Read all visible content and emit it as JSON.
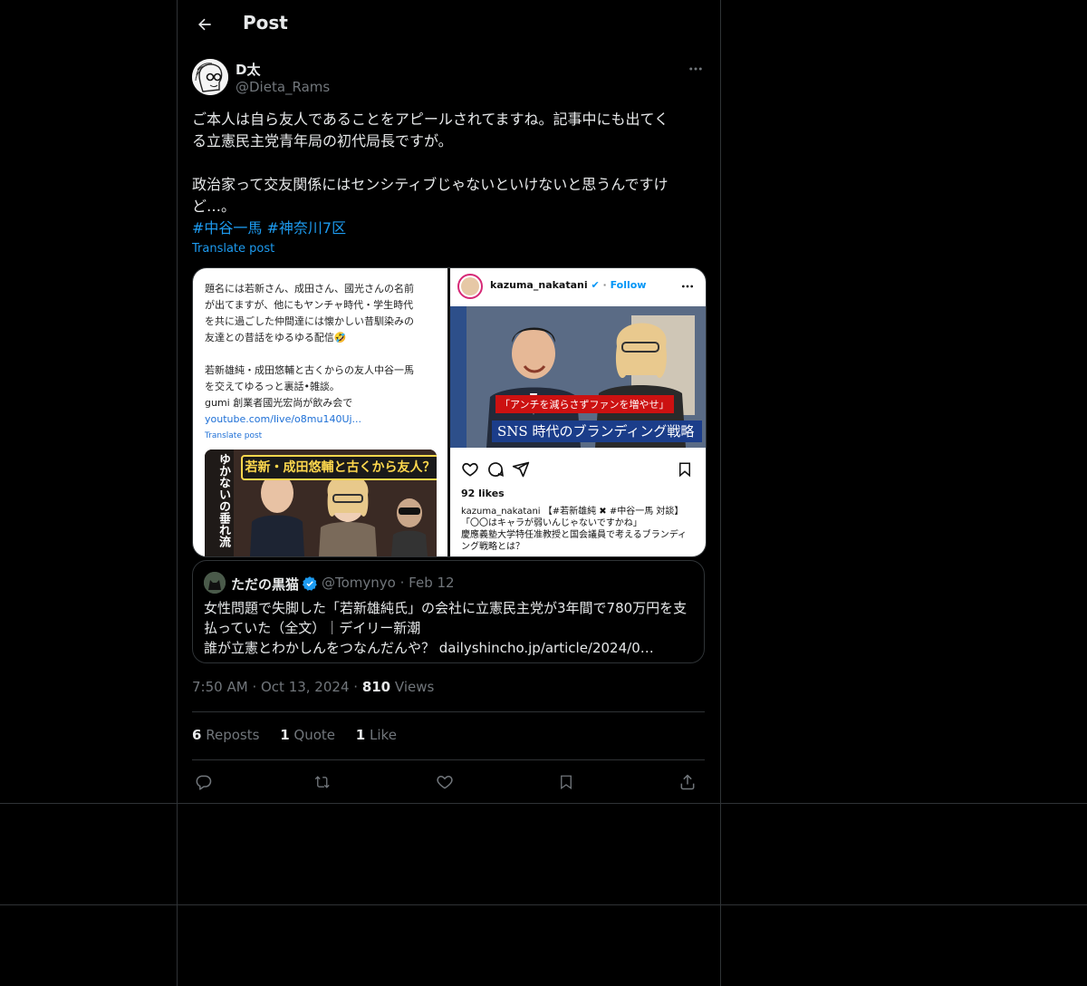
{
  "header": {
    "title": "Post"
  },
  "post": {
    "author_name": "D太",
    "author_handle": "@Dieta_Rams",
    "text_lines": [
      "ご本人は自ら友人であることをアピールされてますね。記事中にも出てく",
      "る立憲民主党青年局の初代局長ですが。",
      "",
      "政治家って交友関係にはセンシティブじゃないといけないと思うんですけ",
      "ど…。"
    ],
    "hashtags": [
      "#中谷一馬",
      "#神奈川7区"
    ],
    "translate_label": "Translate post",
    "time": "7:50 AM",
    "date": "Oct 13, 2024",
    "views_count": "810",
    "views_label": "Views",
    "reposts_count": "6",
    "reposts_label": "Reposts",
    "quotes_count": "1",
    "quotes_label": "Quote",
    "likes_count": "1",
    "likes_label": "Like"
  },
  "media_left": {
    "lines": [
      "題名には若新さん、成田さん、國光さんの名前",
      "が出てますが、他にもヤンチャ時代・学生時代",
      "を共に過ごした仲間達には懐かしい昔馴染みの",
      "友達との昔話をゆるゆる配信🤣",
      "",
      "若新雄純・成田悠輔と古くからの友人中谷一馬",
      "を交えてゆるっと裏話•雑談。",
      "gumi 創業者國光宏尚が飲み会で"
    ],
    "link": "youtube.com/live/o8mu140Uj...",
    "translate_label": "Translate post",
    "thumb_banner": "若新・成田悠輔と古くから友人？",
    "thumb_vertical": "ゆかないの垂れ流"
  },
  "media_right": {
    "user": "kazuma_nakatani",
    "follow": "Follow",
    "sub_caption": "「アンチを減らさずファンを増やせ」",
    "banner": "SNS 時代のブランディング戦略",
    "likes": "92 likes",
    "caption_lines": [
      "kazuma_nakatani 【#若新雄純 ✖ #中谷一馬 対談】",
      "「〇〇はキャラが弱いんじゃないですかね」",
      "慶應義塾大学特任准教授と国会議員で考えるブランディ",
      "ング戦略とは？"
    ]
  },
  "quote": {
    "name": "ただの黒猫",
    "handle": "@Tomynyo",
    "date": "Feb 12",
    "lines": [
      "女性問題で失脚した「若新雄純氏」の会社に立憲民主党が3年間で780万円を支",
      "払っていた（全文）｜デイリー新潮",
      "誰が立憲とわかしんをつなんだんや？ dailyshincho.jp/article/2024/0…"
    ]
  },
  "colors": {
    "accent": "#1d9bf0",
    "border": "#2f3336",
    "muted": "#71767b"
  }
}
